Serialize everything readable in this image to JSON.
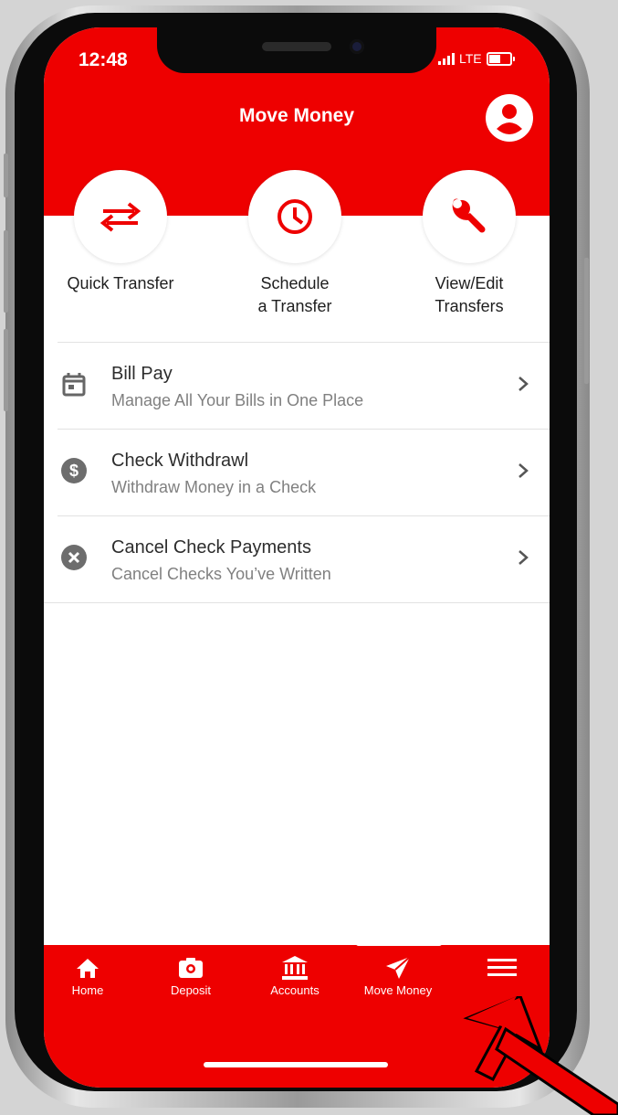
{
  "status_bar": {
    "time": "12:48",
    "network": "LTE"
  },
  "header": {
    "title": "Move Money"
  },
  "quick_actions": [
    {
      "label_line1": "Quick Transfer",
      "label_line2": "",
      "icon": "transfer-arrows-icon"
    },
    {
      "label_line1": "Schedule",
      "label_line2": "a Transfer",
      "icon": "clock-icon"
    },
    {
      "label_line1": "View/Edit",
      "label_line2": "Transfers",
      "icon": "wrench-icon"
    }
  ],
  "menu_items": [
    {
      "title": "Bill Pay",
      "subtitle": "Manage All Your Bills in One Place",
      "icon": "calendar-icon"
    },
    {
      "title": "Check Withdrawl",
      "subtitle": "Withdraw Money in a Check",
      "icon": "dollar-circle-icon"
    },
    {
      "title": "Cancel Check Payments",
      "subtitle": "Cancel Checks You’ve Written",
      "icon": "cancel-circle-icon"
    }
  ],
  "tab_bar": [
    {
      "label": "Home",
      "icon": "home-icon"
    },
    {
      "label": "Deposit",
      "icon": "camera-icon"
    },
    {
      "label": "Accounts",
      "icon": "bank-icon"
    },
    {
      "label": "Move Money",
      "icon": "send-icon",
      "active": true
    },
    {
      "label": "",
      "icon": "hamburger-menu-icon"
    }
  ],
  "colors": {
    "brand_red": "#ee0000",
    "annotation_arrow": "#ee0000"
  }
}
